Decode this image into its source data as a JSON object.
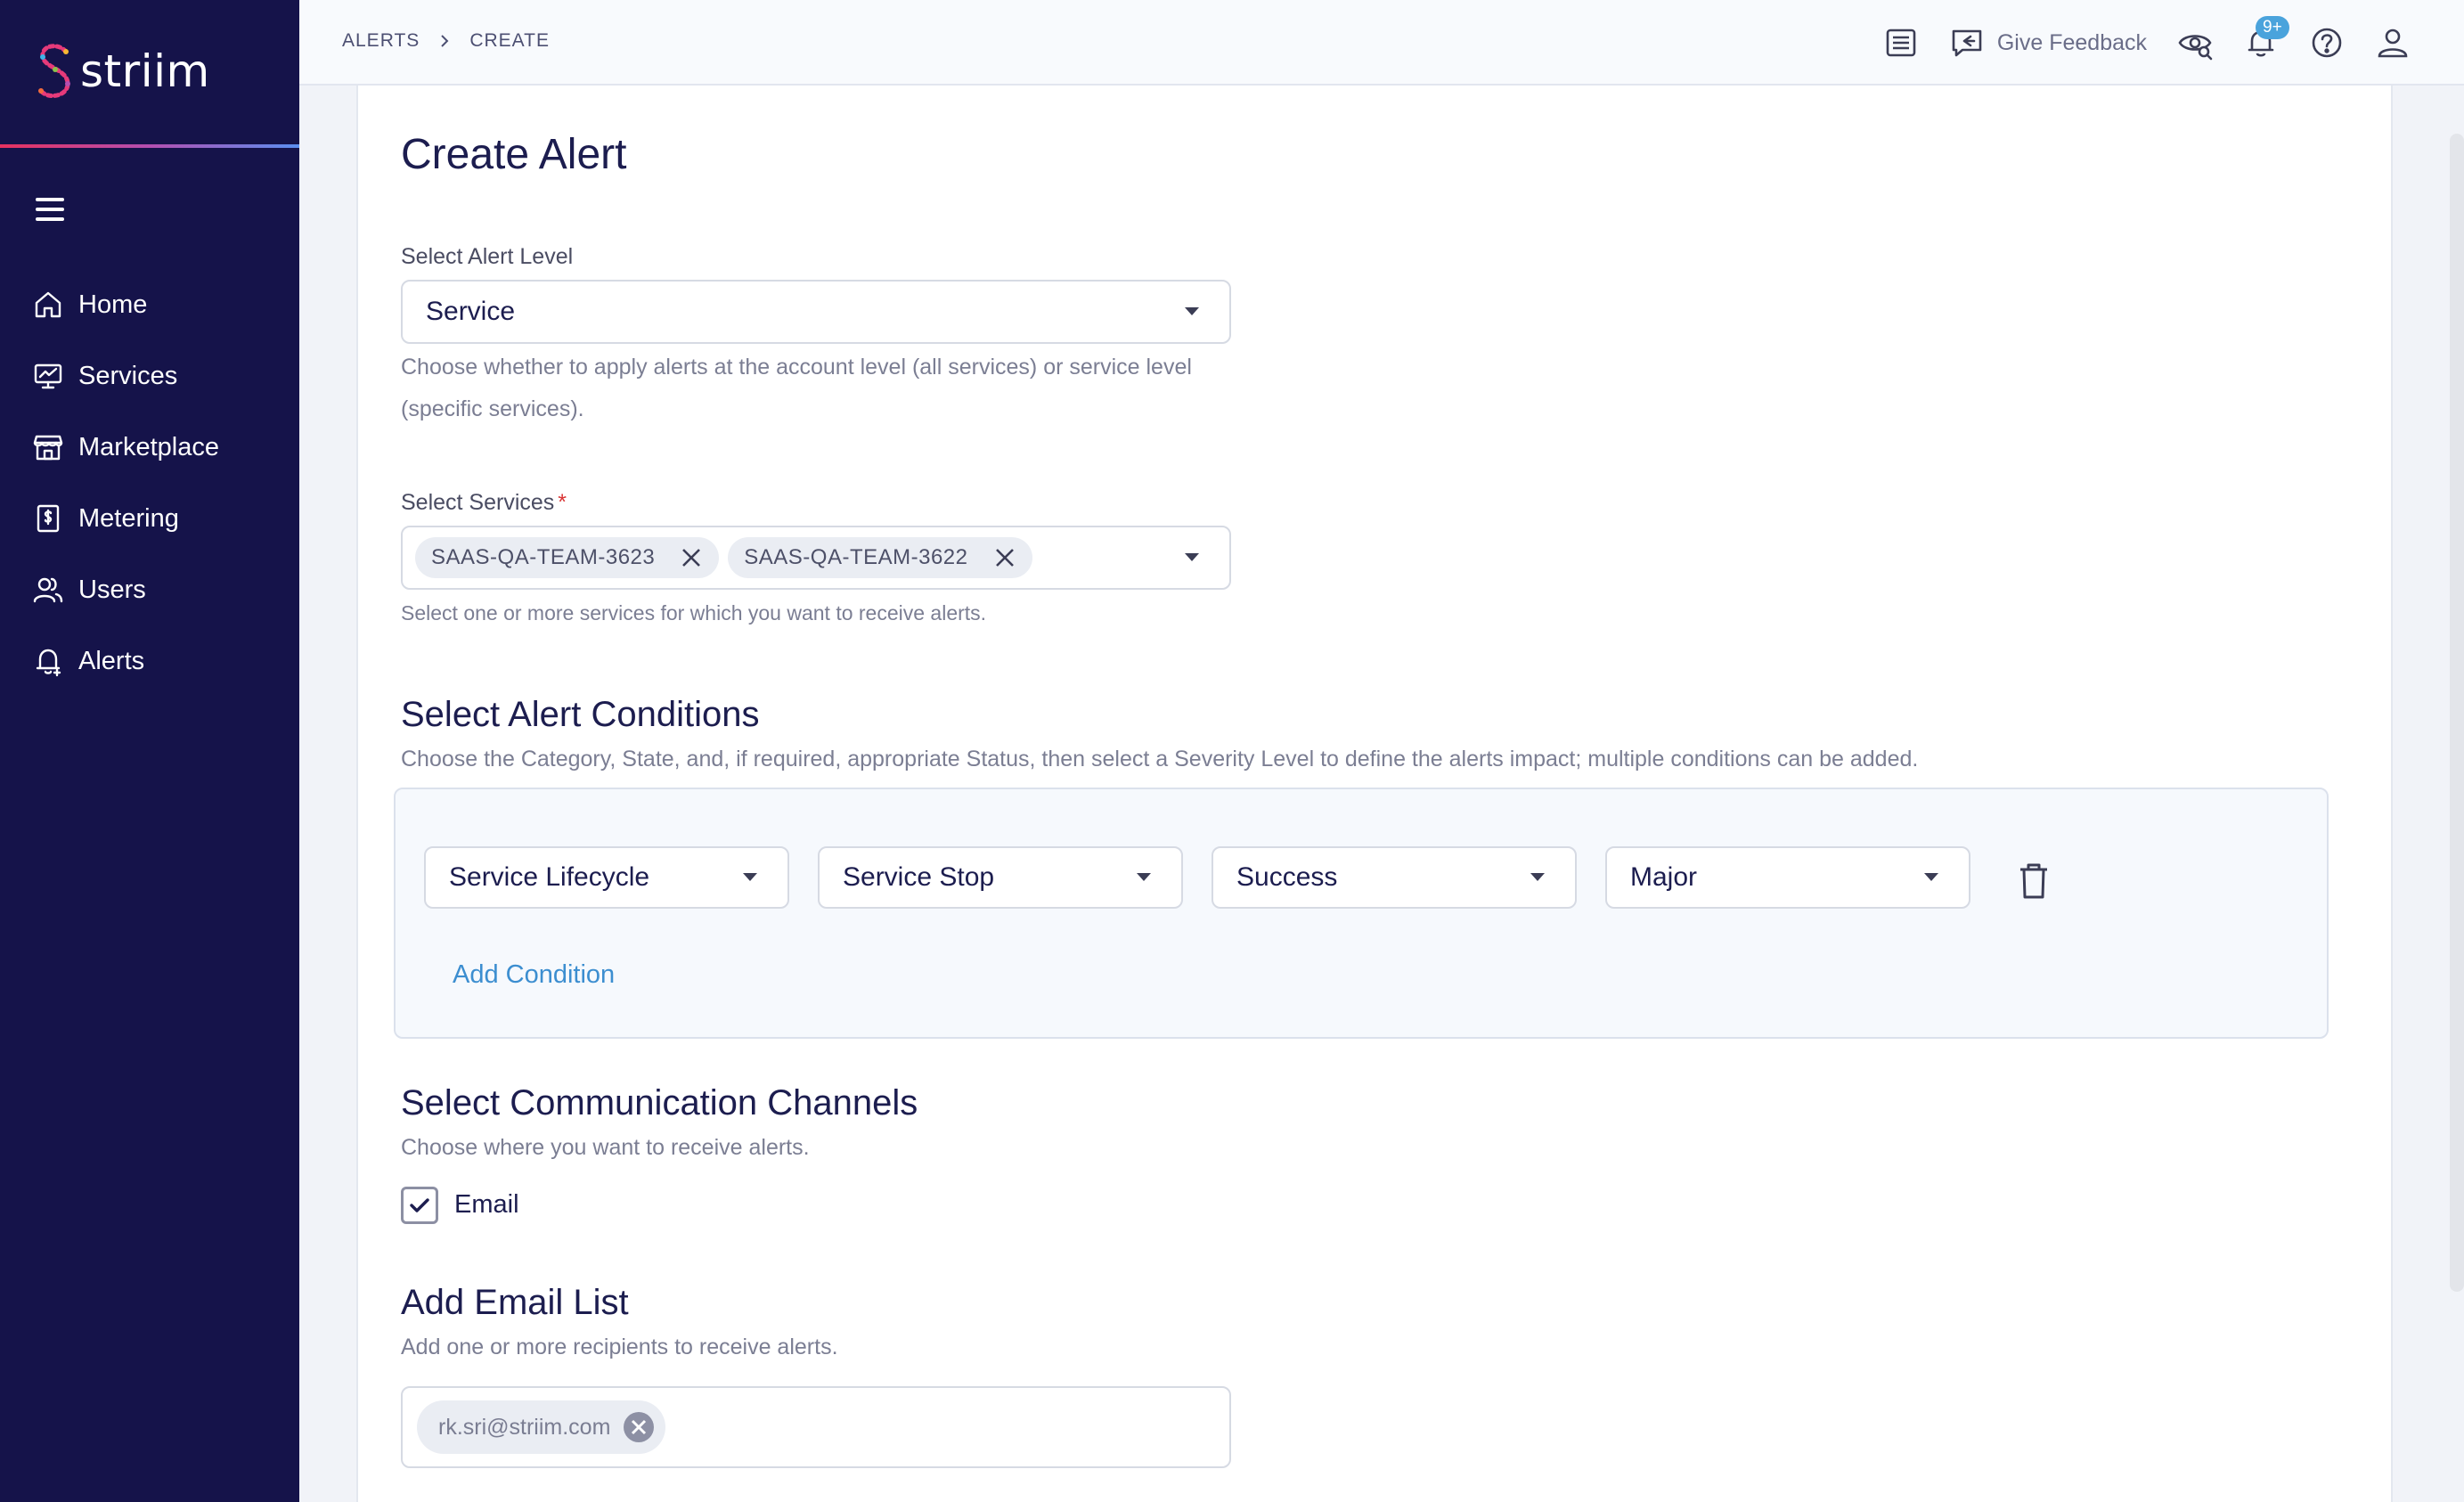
{
  "app": {
    "brand": "striim"
  },
  "sidebar": {
    "items": [
      {
        "label": "Home",
        "icon": "home-icon"
      },
      {
        "label": "Services",
        "icon": "services-icon"
      },
      {
        "label": "Marketplace",
        "icon": "marketplace-icon"
      },
      {
        "label": "Metering",
        "icon": "metering-icon"
      },
      {
        "label": "Users",
        "icon": "users-icon"
      },
      {
        "label": "Alerts",
        "icon": "alerts-icon"
      }
    ]
  },
  "header": {
    "breadcrumb": [
      "ALERTS",
      "CREATE"
    ],
    "feedback_label": "Give Feedback",
    "notification_count": "9+"
  },
  "page": {
    "title": "Create Alert",
    "alert_level": {
      "label": "Select Alert Level",
      "value": "Service",
      "help": "Choose whether to apply alerts at the account level (all services) or service level",
      "help_line2": "(specific services)."
    },
    "services": {
      "label": "Select Services",
      "required_marker": "*",
      "selected": [
        "SAAS-QA-TEAM-3623",
        "SAAS-QA-TEAM-3622"
      ],
      "help": "Select one or more services for which you want to receive alerts."
    },
    "conditions": {
      "title": "Select Alert Conditions",
      "help": "Choose the Category, State, and, if required, appropriate Status, then select a Severity Level to define the alerts impact; multiple conditions can be added.",
      "row": {
        "category": "Service Lifecycle",
        "state": "Service Stop",
        "status": "Success",
        "severity": "Major"
      },
      "add_label": "Add Condition"
    },
    "channels": {
      "title": "Select Communication Channels",
      "help": "Choose where you want to receive alerts.",
      "email_label": "Email",
      "email_checked": true
    },
    "email_list": {
      "title": "Add Email List",
      "help": "Add one or more recipients to receive alerts.",
      "recipients": [
        "rk.sri@striim.com"
      ]
    }
  },
  "colors": {
    "sidebar_bg": "#15134a",
    "accent": "#3c8ed0",
    "title": "#1c1d4f"
  }
}
